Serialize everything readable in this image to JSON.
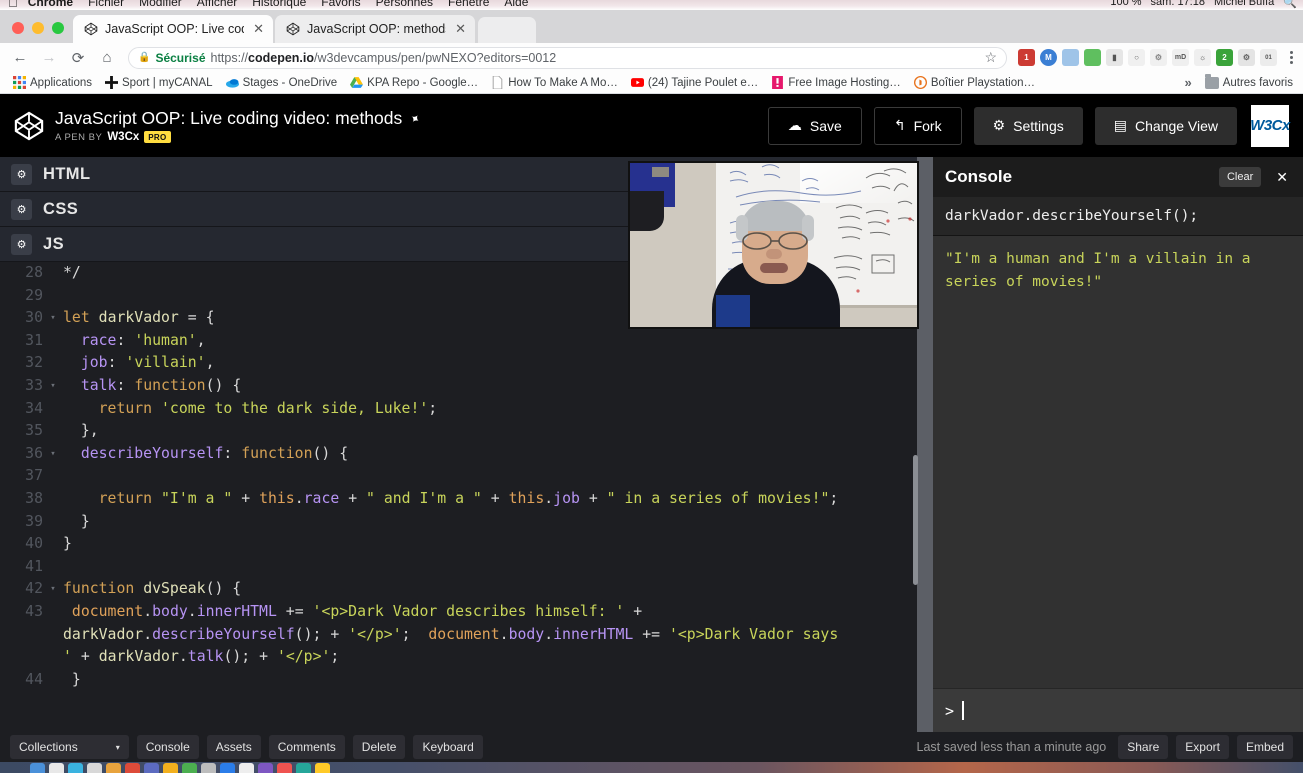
{
  "os_menubar": {
    "apple_icon": "apple-icon",
    "items": [
      "Chrome",
      "Fichier",
      "Modifier",
      "Afficher",
      "Historique",
      "Favoris",
      "Personnes",
      "Fenêtre",
      "Aide"
    ],
    "right_items": [
      "100 %",
      "sam. 17:18",
      "Michel Buffa"
    ]
  },
  "browser": {
    "tabs": [
      {
        "title": "JavaScript OOP: Live coding",
        "title_faded": "vi",
        "active": true,
        "favicon": "codepen-icon"
      },
      {
        "title": "JavaScript OOP: methods",
        "title_faded": "and",
        "active": false,
        "favicon": "codepen-icon"
      }
    ],
    "nav": {
      "back": "back-arrow-icon",
      "forward": "forward-arrow-icon",
      "reload": "reload-icon",
      "home": "home-icon"
    },
    "omnibox": {
      "lock_icon": "lock-icon",
      "secure_label": "Sécurisé",
      "scheme": "https://",
      "domain": "codepen.io",
      "path": "/w3devcampus/pen/pwNEXO?editors=0012",
      "bookmark_icon": "star-icon"
    },
    "bookmarks": [
      {
        "label": "Applications",
        "icon": "apps-grid-icon"
      },
      {
        "label": "Sport | myCANAL",
        "icon": "plus-icon"
      },
      {
        "label": "Stages - OneDrive",
        "icon": "onedrive-icon"
      },
      {
        "label": "KPA Repo - Google…",
        "icon": "google-drive-icon"
      },
      {
        "label": "How To Make A Mo…",
        "icon": "document-icon"
      },
      {
        "label": "(24) Tajine Poulet e…",
        "icon": "youtube-icon"
      },
      {
        "label": "Free Image Hosting…",
        "icon": "image-host-icon"
      },
      {
        "label": "Boîtier Playstation…",
        "icon": "playstation-icon"
      }
    ],
    "bookmarks_overflow": "»",
    "other_bookmarks": "Autres favoris"
  },
  "pen": {
    "logo_icon": "codepen-logo-icon",
    "title": "JavaScript OOP: Live coding video: methods",
    "pin_icon": "pin-icon",
    "byline_prefix": "A PEN BY",
    "author": "W3Cx",
    "pro_badge": "PRO",
    "actions": [
      {
        "label": "Save",
        "icon": "cloud-icon",
        "style": "dark"
      },
      {
        "label": "Fork",
        "icon": "fork-icon",
        "style": "dark"
      },
      {
        "label": "Settings",
        "icon": "gear-icon",
        "style": "grey"
      },
      {
        "label": "Change View",
        "icon": "view-icon",
        "style": "grey"
      }
    ],
    "w3c_badge": "W3Cx"
  },
  "editor": {
    "tabs": [
      {
        "label": "HTML",
        "gear_icon": "gear-icon"
      },
      {
        "label": "CSS",
        "gear_icon": "gear-icon"
      },
      {
        "label": "JS",
        "gear_icon": "gear-icon"
      }
    ],
    "lines": [
      {
        "num": "28",
        "fold": "",
        "text": "*/"
      },
      {
        "num": "29",
        "fold": "",
        "text": ""
      },
      {
        "num": "30",
        "fold": "▾",
        "text": "let darkVador = {"
      },
      {
        "num": "31",
        "fold": "",
        "text": "  race: 'human',"
      },
      {
        "num": "32",
        "fold": "",
        "text": "  job: 'villain',"
      },
      {
        "num": "33",
        "fold": "▾",
        "text": "  talk: function() {"
      },
      {
        "num": "34",
        "fold": "",
        "text": "    return 'come to the dark side, Luke!';"
      },
      {
        "num": "35",
        "fold": "",
        "text": "  },"
      },
      {
        "num": "36",
        "fold": "▾",
        "text": "  describeYourself: function() {"
      },
      {
        "num": "37",
        "fold": "",
        "text": ""
      },
      {
        "num": "38",
        "fold": "",
        "text": "    return \"I'm a \" + this.race + \" and I'm a \" + this.job + \" in a series of movies!\";"
      },
      {
        "num": "39",
        "fold": "",
        "text": "  }"
      },
      {
        "num": "40",
        "fold": "",
        "text": "}"
      },
      {
        "num": "41",
        "fold": "",
        "text": ""
      },
      {
        "num": "42",
        "fold": "▾",
        "text": "function dvSpeak() {"
      },
      {
        "num": "43",
        "fold": "",
        "text": " document.body.innerHTML += '<p>Dark Vador describes himself: ' + darkVador.describeYourself(); + '</p>';  document.body.innerHTML += '<p>Dark Vador says ' + darkVador.talk(); + '</p>';"
      },
      {
        "num": "44",
        "fold": "",
        "text": " }"
      }
    ]
  },
  "video": {
    "label": "live-coding-webcam-overlay"
  },
  "console": {
    "title": "Console",
    "clear_label": "Clear",
    "close_icon": "close-icon",
    "command": "darkVador.describeYourself();",
    "output": "\"I'm a human and I'm a villain in a series of movies!\"",
    "prompt_symbol": ">",
    "prompt_value": ""
  },
  "bottom_bar": {
    "collections_label": "Collections",
    "collections_caret": "▾",
    "buttons": [
      "Console",
      "Assets",
      "Comments",
      "Delete",
      "Keyboard"
    ],
    "saved_status": "Last saved less than a minute ago",
    "right_buttons": [
      "Share",
      "Export",
      "Embed"
    ]
  },
  "colors": {
    "accent_yellow": "#ffdd40",
    "console_output": "#c8d45a",
    "editor_bg": "#1d1e22",
    "pen_header_bg": "#000000",
    "secure_green": "#0b8043"
  }
}
